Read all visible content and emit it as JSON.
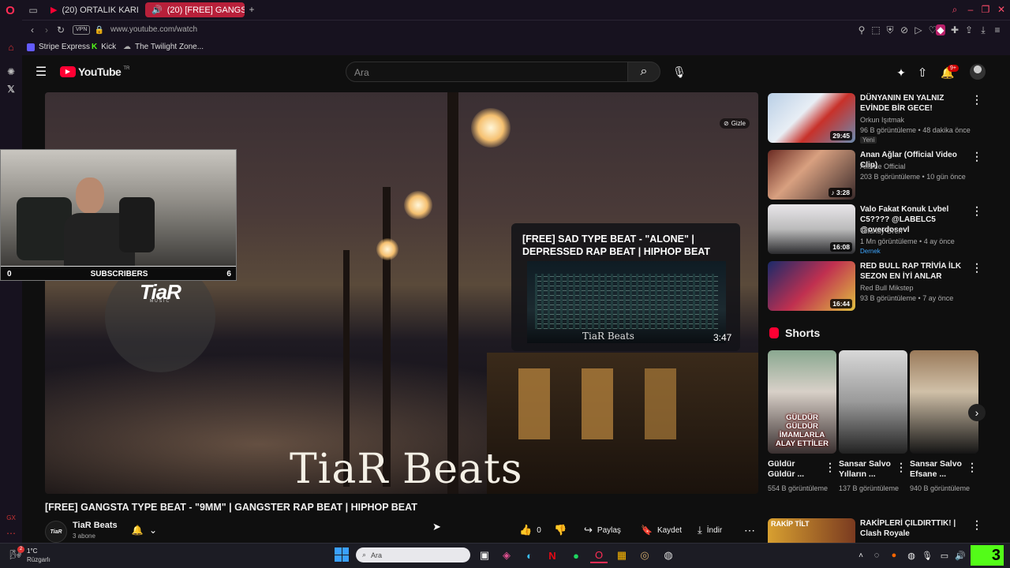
{
  "browser": {
    "tabs": [
      {
        "label": "(20) ORTALIK KARIŞIK! @c"
      },
      {
        "label": "(20) [FREE] GANGSTA"
      }
    ],
    "new_tab": "+",
    "vpn": "VPN",
    "url": "www.youtube.com/watch",
    "bookmarks": [
      {
        "label": "Stripe Express"
      },
      {
        "label": "Kick"
      },
      {
        "label": "The Twilight Zone..."
      }
    ]
  },
  "youtube": {
    "logo": "YouTube",
    "region": "TR",
    "search_placeholder": "Ara",
    "notif_badge": "9+",
    "player": {
      "hide_label": "Gizle",
      "watermark": "TiaR Beats",
      "channel_logo": "TiaR",
      "channel_logo_sub": "MUSIC",
      "endcard_title": "[FREE] SAD TYPE BEAT - \"ALONE\" | DEPRESSED RAP BEAT | HIPHOP BEAT",
      "endcard_watermark": "TiaR Beats",
      "endcard_duration": "3:47"
    },
    "webcam": {
      "left_count": "0",
      "label": "SUBSCRIBERS",
      "right_count": "6"
    },
    "video": {
      "title": "[FREE] GANGSTA TYPE BEAT - \"9MM\" | GANGSTER RAP BEAT | HIPHOP BEAT",
      "channel": "TiaR Beats",
      "channel_avatar": "TiaR",
      "subs": "3 abone",
      "likes": "0",
      "share": "Paylaş",
      "save": "Kaydet",
      "download": "İndir"
    },
    "recommended": [
      {
        "title": "DÜNYANIN EN YALNIZ EVİNDE BİR GECE!",
        "channel": "Orkun Işıtmak",
        "stats": "96 B görüntüleme • 48 dakika önce",
        "badge": "Yeni",
        "duration": "29:45"
      },
      {
        "title": "Anan Ağlar (Official Video Clip)",
        "channel": "Allame Official",
        "stats": "203 B görüntüleme • 10 gün önce",
        "badge": "",
        "duration": "♪ 3:28"
      },
      {
        "title": "Valo Fakat Konuk Lvbel C5???? @LABELC5 @overdosevl",
        "channel": "Tolunay Ören",
        "stats": "1 Mn görüntüleme • 4 ay önce",
        "badge": "Dernek",
        "duration": "16:08"
      },
      {
        "title": "RED BULL RAP TRİVİA İLK SEZON EN İYİ ANLAR",
        "channel": "Red Bull Mikstep",
        "stats": "93 B görüntüleme • 7 ay önce",
        "badge": "",
        "duration": "16:44"
      }
    ],
    "shorts": {
      "heading": "Shorts",
      "items": [
        {
          "title": "Güldür Güldür ...",
          "views": "554 B görüntüleme",
          "overlay": "GÜLDÜR GÜLDÜR İMAMLARLA ALAY ETTİLER"
        },
        {
          "title": "Sansar Salvo Yılların ...",
          "views": "137 B görüntüleme",
          "overlay": ""
        },
        {
          "title": "Sansar Salvo Efsane ...",
          "views": "940 B görüntüleme",
          "overlay": ""
        }
      ]
    },
    "bottom_rec": {
      "title": "RAKİPLERİ ÇILDIRTTIK! | Clash Royale",
      "thumb_text": "RAKİP TİLT"
    }
  },
  "taskbar": {
    "weather_temp": "1°C",
    "weather_desc": "Rüzgarlı",
    "weather_badge": "2",
    "search_placeholder": "Ara",
    "corner_logo": "3"
  },
  "colors": {
    "accent": "#ff0033",
    "browser_bg": "#17121f",
    "yt_bg": "#0f0f0f"
  }
}
